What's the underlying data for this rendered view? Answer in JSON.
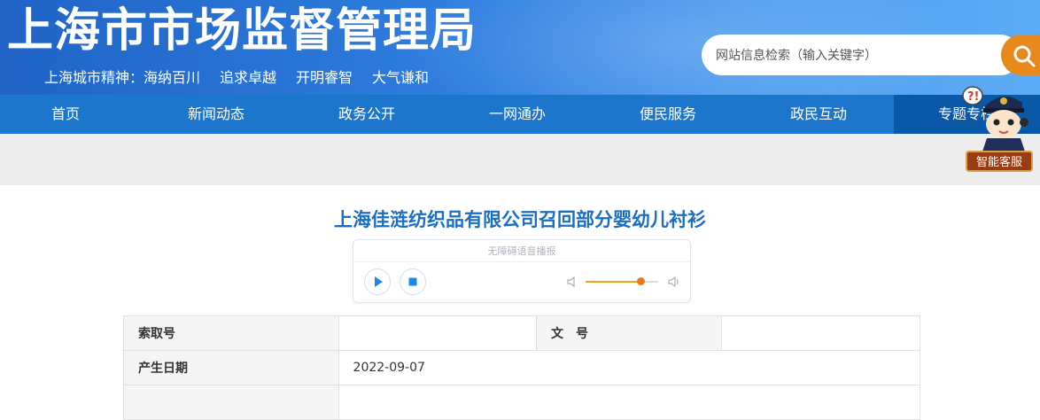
{
  "header": {
    "site_title": "上海市市场监督管理局",
    "spirit_items": [
      "上海城市精神：海纳百川",
      "追求卓越",
      "开明睿智",
      "大气谦和"
    ],
    "search_placeholder": "网站信息检索（输入关键字）"
  },
  "nav": {
    "items": [
      {
        "label": "首页"
      },
      {
        "label": "新闻动态"
      },
      {
        "label": "政务公开"
      },
      {
        "label": "一网通办"
      },
      {
        "label": "便民服务"
      },
      {
        "label": "政民互动"
      },
      {
        "label": "专题专栏"
      }
    ],
    "active_index": 6
  },
  "assistant": {
    "label": "智能客服"
  },
  "article": {
    "title": "上海佳涟纺织品有限公司召回部分婴幼儿衬衫"
  },
  "player": {
    "label": "无障碍语音播报",
    "volume_fraction": 0.75
  },
  "info_table": {
    "rows": [
      {
        "k1": "索取号",
        "v1": "",
        "k2": "文　号",
        "v2": ""
      },
      {
        "k1": "产生日期",
        "v1": "2022-09-07",
        "k2": "",
        "v2": ""
      }
    ]
  },
  "colors": {
    "banner": "#2f7fe0",
    "nav": "#1c76cb",
    "nav_active": "#0a58a8",
    "search_button": "#e8891d",
    "title": "#1a6fc4"
  },
  "icons": {
    "search": "search-icon",
    "play": "play-icon",
    "stop": "stop-icon",
    "volume_low": "volume-low-icon",
    "volume_high": "volume-high-icon",
    "assistant": "police-mascot-icon"
  }
}
